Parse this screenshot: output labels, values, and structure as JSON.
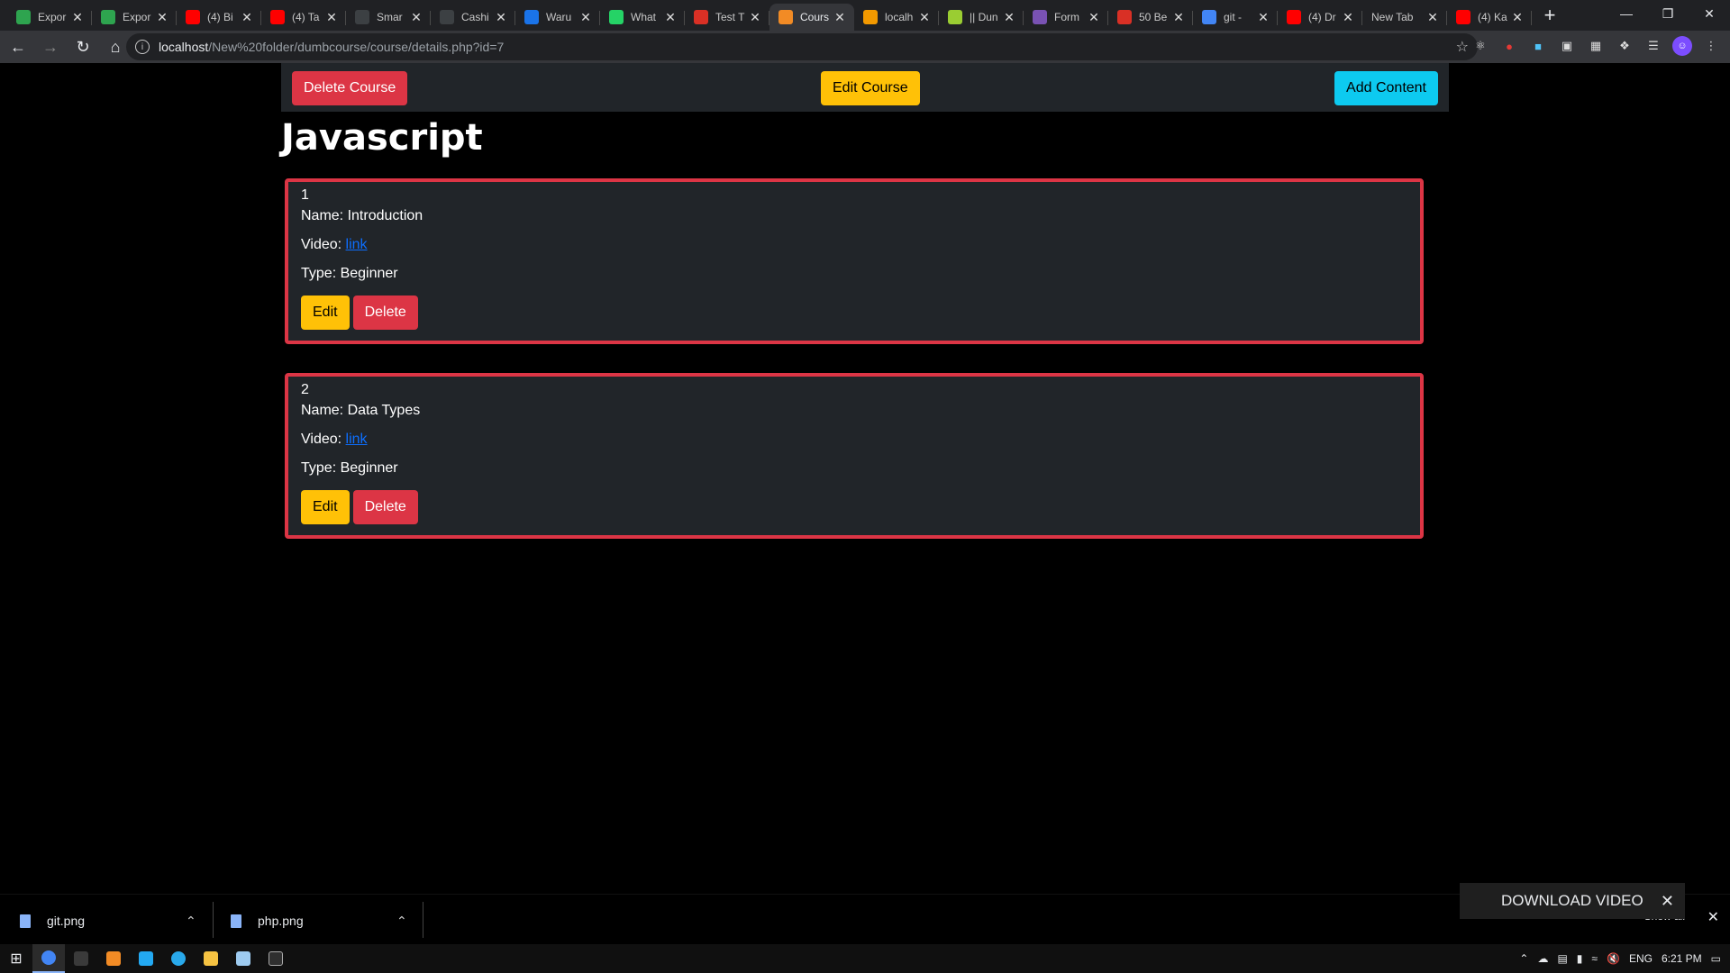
{
  "browser": {
    "tabs": [
      {
        "title": "Expor",
        "favicon_color": "#2ea44f",
        "icon": "wagtail-icon"
      },
      {
        "title": "Expor",
        "favicon_color": "#2ea44f",
        "icon": "wagtail-icon"
      },
      {
        "title": "(4) Bi",
        "favicon_color": "#ff0000",
        "icon": "youtube-icon"
      },
      {
        "title": "(4) Ta",
        "favicon_color": "#ff0000",
        "icon": "youtube-icon"
      },
      {
        "title": "Smar",
        "favicon_color": "#3c4043",
        "icon": "moon-icon"
      },
      {
        "title": "Cashi",
        "favicon_color": "#3c4043",
        "icon": "moon-icon"
      },
      {
        "title": "Waru",
        "favicon_color": "#1a73e8",
        "icon": "word-icon"
      },
      {
        "title": "What",
        "favicon_color": "#25d366",
        "icon": "whatsapp-icon"
      },
      {
        "title": "Test T",
        "favicon_color": "#d93025",
        "icon": "test-icon"
      },
      {
        "title": "Cours",
        "favicon_color": "#f28b25",
        "icon": "xampp-icon",
        "active": true
      },
      {
        "title": "localh",
        "favicon_color": "#f29900",
        "icon": "phpmyadmin-icon"
      },
      {
        "title": "|| Dun",
        "favicon_color": "#9acd32",
        "icon": "page-icon"
      },
      {
        "title": "Form",
        "favicon_color": "#7952b3",
        "icon": "bootstrap-icon"
      },
      {
        "title": "50 Be",
        "favicon_color": "#d93025",
        "icon": "mail-icon"
      },
      {
        "title": "git - ",
        "favicon_color": "#4285f4",
        "icon": "google-icon"
      },
      {
        "title": "(4) Dr",
        "favicon_color": "#ff0000",
        "icon": "youtube-icon"
      },
      {
        "title": "New Tab",
        "favicon_color": "",
        "icon": ""
      },
      {
        "title": "(4) Ka",
        "favicon_color": "#ff0000",
        "icon": "youtube-icon"
      }
    ],
    "new_tab_symbol": "+",
    "url_host": "localhost",
    "url_path": "/New%20folder/dumbcourse/course/details.php?id=7"
  },
  "toolbar": {
    "delete_course_label": "Delete Course",
    "edit_course_label": "Edit Course",
    "add_content_label": "Add Content"
  },
  "course": {
    "title": "Javascript",
    "items": [
      {
        "number": "1",
        "name_label": "Name: ",
        "name": "Introduction",
        "video_label": "Video: ",
        "video_link_text": "link",
        "type_label": "Type: ",
        "type": "Beginner",
        "edit_label": "Edit",
        "delete_label": "Delete"
      },
      {
        "number": "2",
        "name_label": "Name: ",
        "name": "Data Types",
        "video_label": "Video: ",
        "video_link_text": "link",
        "type_label": "Type: ",
        "type": "Beginner",
        "edit_label": "Edit",
        "delete_label": "Delete"
      }
    ]
  },
  "downloads": {
    "files": [
      {
        "name": "git.png"
      },
      {
        "name": "php.png"
      }
    ],
    "show_all_label": "Show all",
    "download_video_label": "DOWNLOAD VIDEO"
  },
  "taskbar": {
    "language": "ENG",
    "time": "6:21 PM"
  },
  "colors": {
    "danger": "#dc3545",
    "warning": "#ffc107",
    "info": "#0dcaf0",
    "card_bg": "#212529",
    "link": "#0d6efd"
  }
}
